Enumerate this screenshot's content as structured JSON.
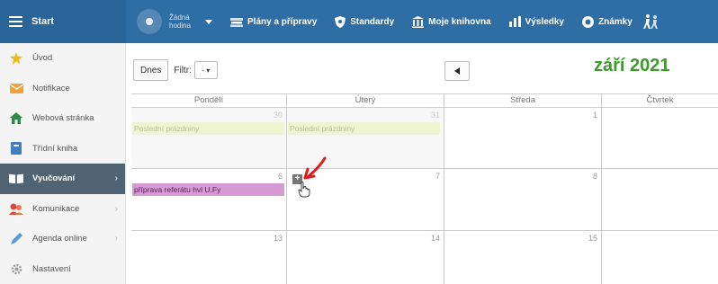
{
  "topbar": {
    "start_label": "Start",
    "no_hour_label": "Žádná hodina",
    "nav": [
      {
        "label": "Plány a přípravy",
        "icon": "book-stack-icon"
      },
      {
        "label": "Standardy",
        "icon": "shield-icon"
      },
      {
        "label": "Moje knihovna",
        "icon": "library-icon"
      },
      {
        "label": "Výsledky",
        "icon": "bar-chart-icon"
      },
      {
        "label": "Známky",
        "icon": "badge-icon"
      }
    ],
    "colors": {
      "bar": "#2f6ea4",
      "start_bg": "#2a659a"
    }
  },
  "sidebar": {
    "items": [
      {
        "label": "Úvod",
        "icon": "star-icon"
      },
      {
        "label": "Notifikace",
        "icon": "envelope-icon"
      },
      {
        "label": "Webová stránka",
        "icon": "home-icon"
      },
      {
        "label": "Třídní kniha",
        "icon": "notebook-icon"
      },
      {
        "label": "Vyučování",
        "icon": "open-book-icon",
        "active": true
      },
      {
        "label": "Komunikace",
        "icon": "people-icon"
      },
      {
        "label": "Agenda online",
        "icon": "pencil-icon"
      },
      {
        "label": "Nastavení",
        "icon": "gear-icon"
      }
    ],
    "chevron": "›",
    "colors": {
      "active_bg": "#4f6372"
    }
  },
  "toolbar": {
    "today_label": "Dnes",
    "filter_label": "Filtr:",
    "filter_value": "- ▾"
  },
  "calendar": {
    "month_title": "září 2021",
    "day_headers": [
      "Pondělí",
      "Úterý",
      "Středa",
      "Čtvrtek"
    ],
    "weeks": [
      {
        "days": [
          "30",
          "31",
          "1",
          ""
        ]
      },
      {
        "days": [
          "6",
          "7",
          "8",
          ""
        ]
      },
      {
        "days": [
          "13",
          "14",
          "15",
          ""
        ]
      }
    ],
    "events": {
      "holiday_mon": "Poslední prázdniny",
      "holiday_tue": "Poslední prázdniny",
      "task_mon": "příprava referátu hvl U.Fy"
    },
    "add_symbol": "+",
    "colors": {
      "month_title": "#3a9a2a",
      "holiday": "#eef4cf",
      "task": "#d59ad3"
    }
  }
}
